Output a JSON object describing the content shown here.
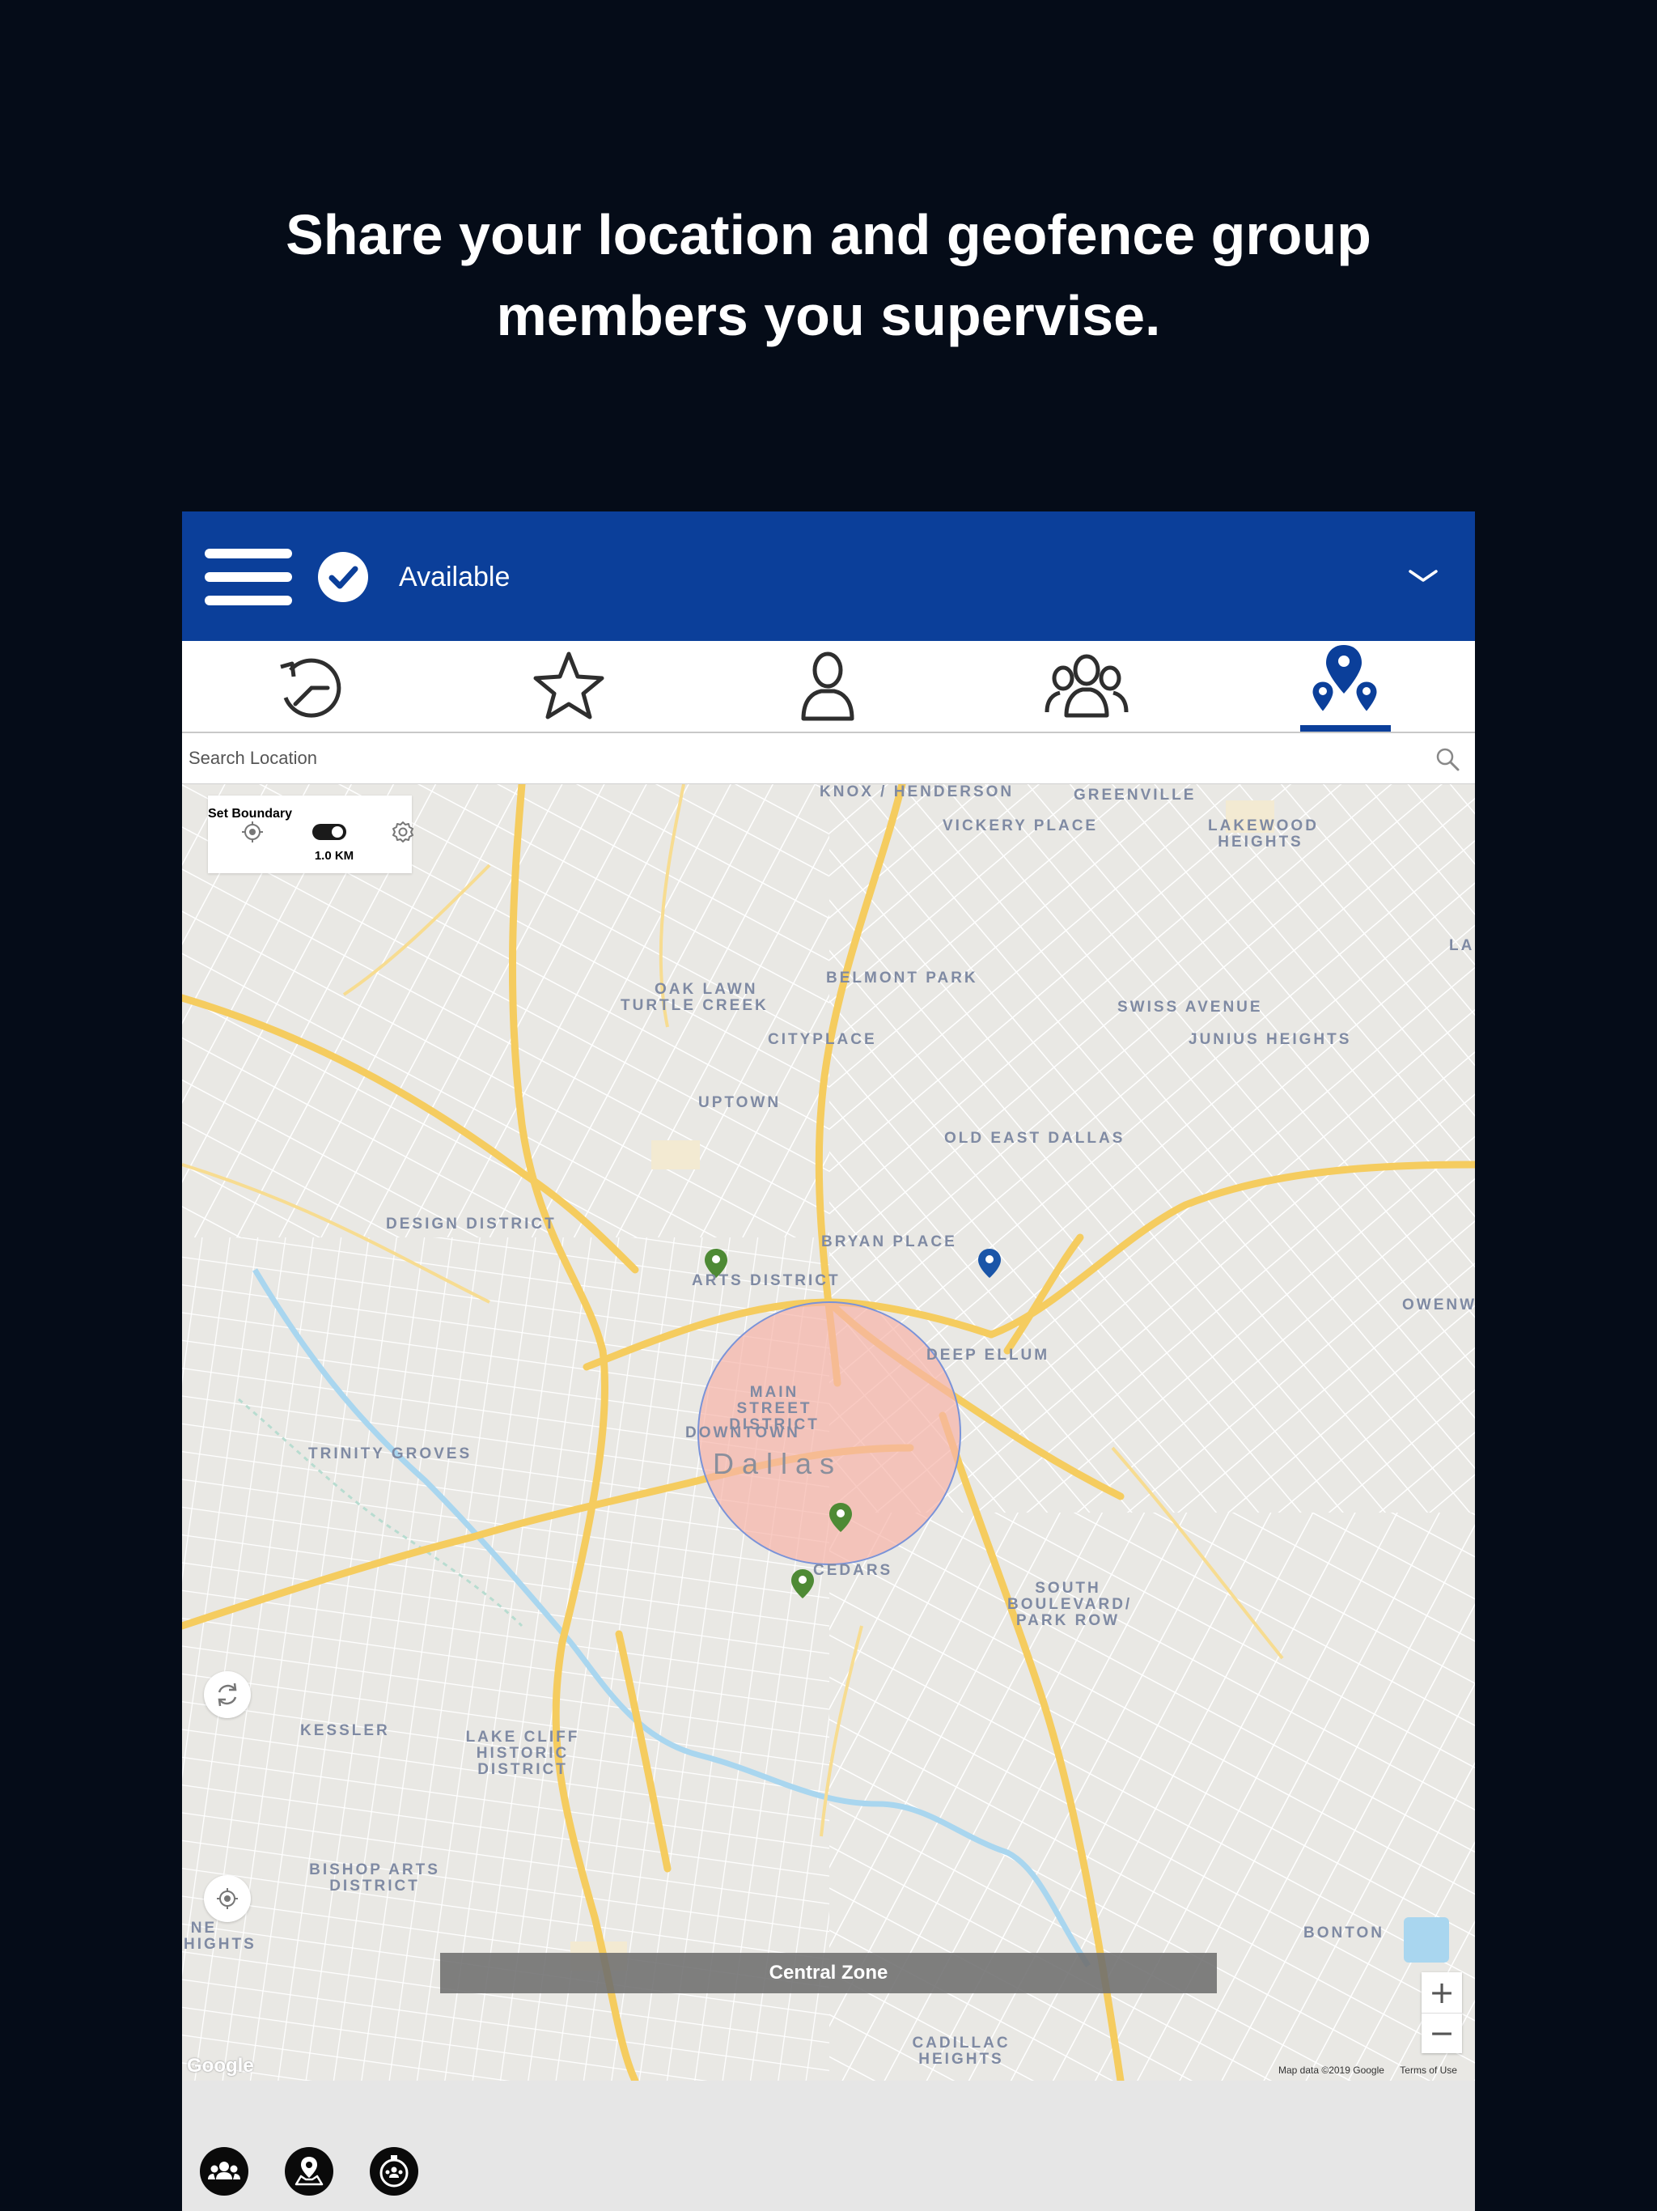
{
  "headline": {
    "line1": "Share your location and geofence group",
    "line2": "members you supervise."
  },
  "app_bar": {
    "status": "Available",
    "menu_icon": "hamburger-menu-icon",
    "status_icon": "check-circle-icon",
    "dropdown_icon": "chevron-down-icon",
    "color": "#0b3f9a"
  },
  "tabs": [
    {
      "icon": "history-icon",
      "active": false
    },
    {
      "icon": "star-icon",
      "active": false
    },
    {
      "icon": "person-icon",
      "active": false
    },
    {
      "icon": "group-icon",
      "active": false
    },
    {
      "icon": "map-pins-icon",
      "active": true
    }
  ],
  "search": {
    "placeholder": "Search Location",
    "icon": "search-icon"
  },
  "boundary_panel": {
    "title": "Set Boundary",
    "radius": "1.0 KM",
    "icons": [
      "locate-icon",
      "toggle-icon",
      "settings-icon"
    ]
  },
  "map": {
    "city": "Dallas",
    "neighborhoods": [
      "KNOX / HENDERSON",
      "GREENVILLE",
      "VICKERY PLACE",
      "LAKEWOOD HEIGHTS",
      "BELMONT PARK",
      "OAK LAWN",
      "TURTLE CREEK",
      "SWISS AVENUE",
      "JUNIUS HEIGHTS",
      "CITYPLACE",
      "UPTOWN",
      "OLD EAST DALLAS",
      "DESIGN DISTRICT",
      "BRYAN PLACE",
      "ARTS DISTRICT",
      "OWENWO",
      "DEEP ELLUM",
      "MAIN STREET DISTRICT",
      "DOWNTOWN",
      "TRINITY GROVES",
      "CEDARS",
      "SOUTH BOULEVARD/ PARK ROW",
      "KESSLER",
      "LAKE CLIFF HISTORIC DISTRICT",
      "BISHOP ARTS DISTRICT",
      "BONTON",
      "CADILLAC HEIGHTS",
      "LA",
      "NE HIGHTS"
    ],
    "zone": "Central Zone",
    "zoom_in": "+",
    "zoom_out": "−",
    "provider": "Google",
    "attribution": "Map data ©2019 Google",
    "terms": "Terms of Use",
    "geofence_color": "#f6b3a8",
    "member_pin_color": "#4e8a35",
    "self_pin_color": "#1a55a8"
  },
  "bottom_actions": [
    {
      "icon": "group-members-icon"
    },
    {
      "icon": "map-location-icon"
    },
    {
      "icon": "group-timer-icon"
    }
  ]
}
